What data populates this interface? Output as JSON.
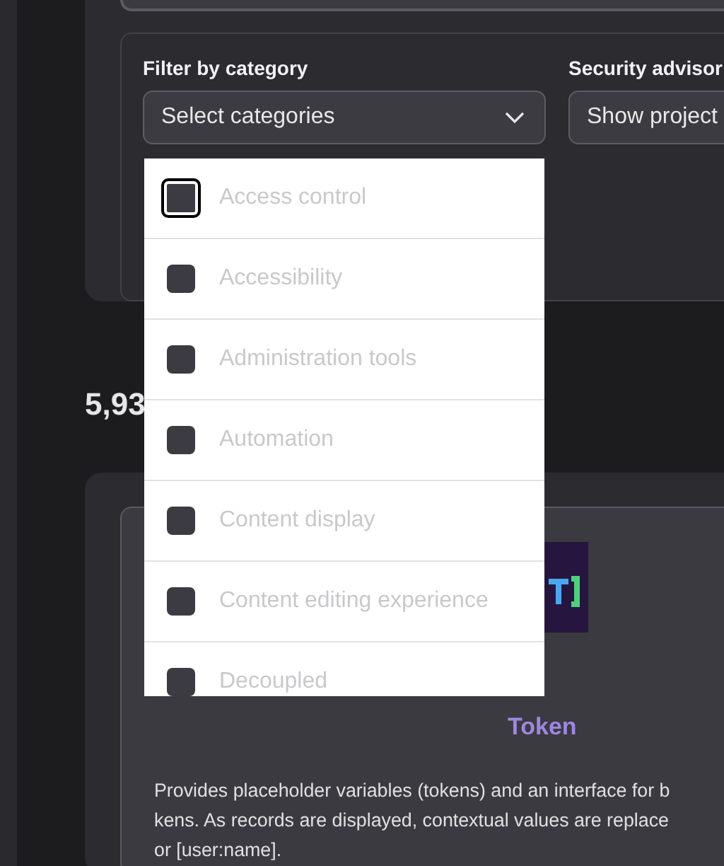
{
  "filters": [
    {
      "label": "Filter by category",
      "value": "Select categories"
    },
    {
      "label": "Security advisor",
      "value": "Show project"
    }
  ],
  "category_options": [
    {
      "label": "Access control",
      "checked": false,
      "focused": true
    },
    {
      "label": "Accessibility",
      "checked": false,
      "focused": false
    },
    {
      "label": "Administration tools",
      "checked": false,
      "focused": false
    },
    {
      "label": "Automation",
      "checked": false,
      "focused": false
    },
    {
      "label": "Content display",
      "checked": false,
      "focused": false
    },
    {
      "label": "Content editing experience",
      "checked": false,
      "focused": false
    },
    {
      "label": "Decoupled",
      "checked": false,
      "focused": false
    }
  ],
  "result_count": "5,93",
  "project": {
    "title": "Token",
    "description_lines": [
      "Provides placeholder variables (tokens) and an interface for b",
      "kens. As records are displayed, contextual values are replace",
      "or [user:name]."
    ]
  }
}
